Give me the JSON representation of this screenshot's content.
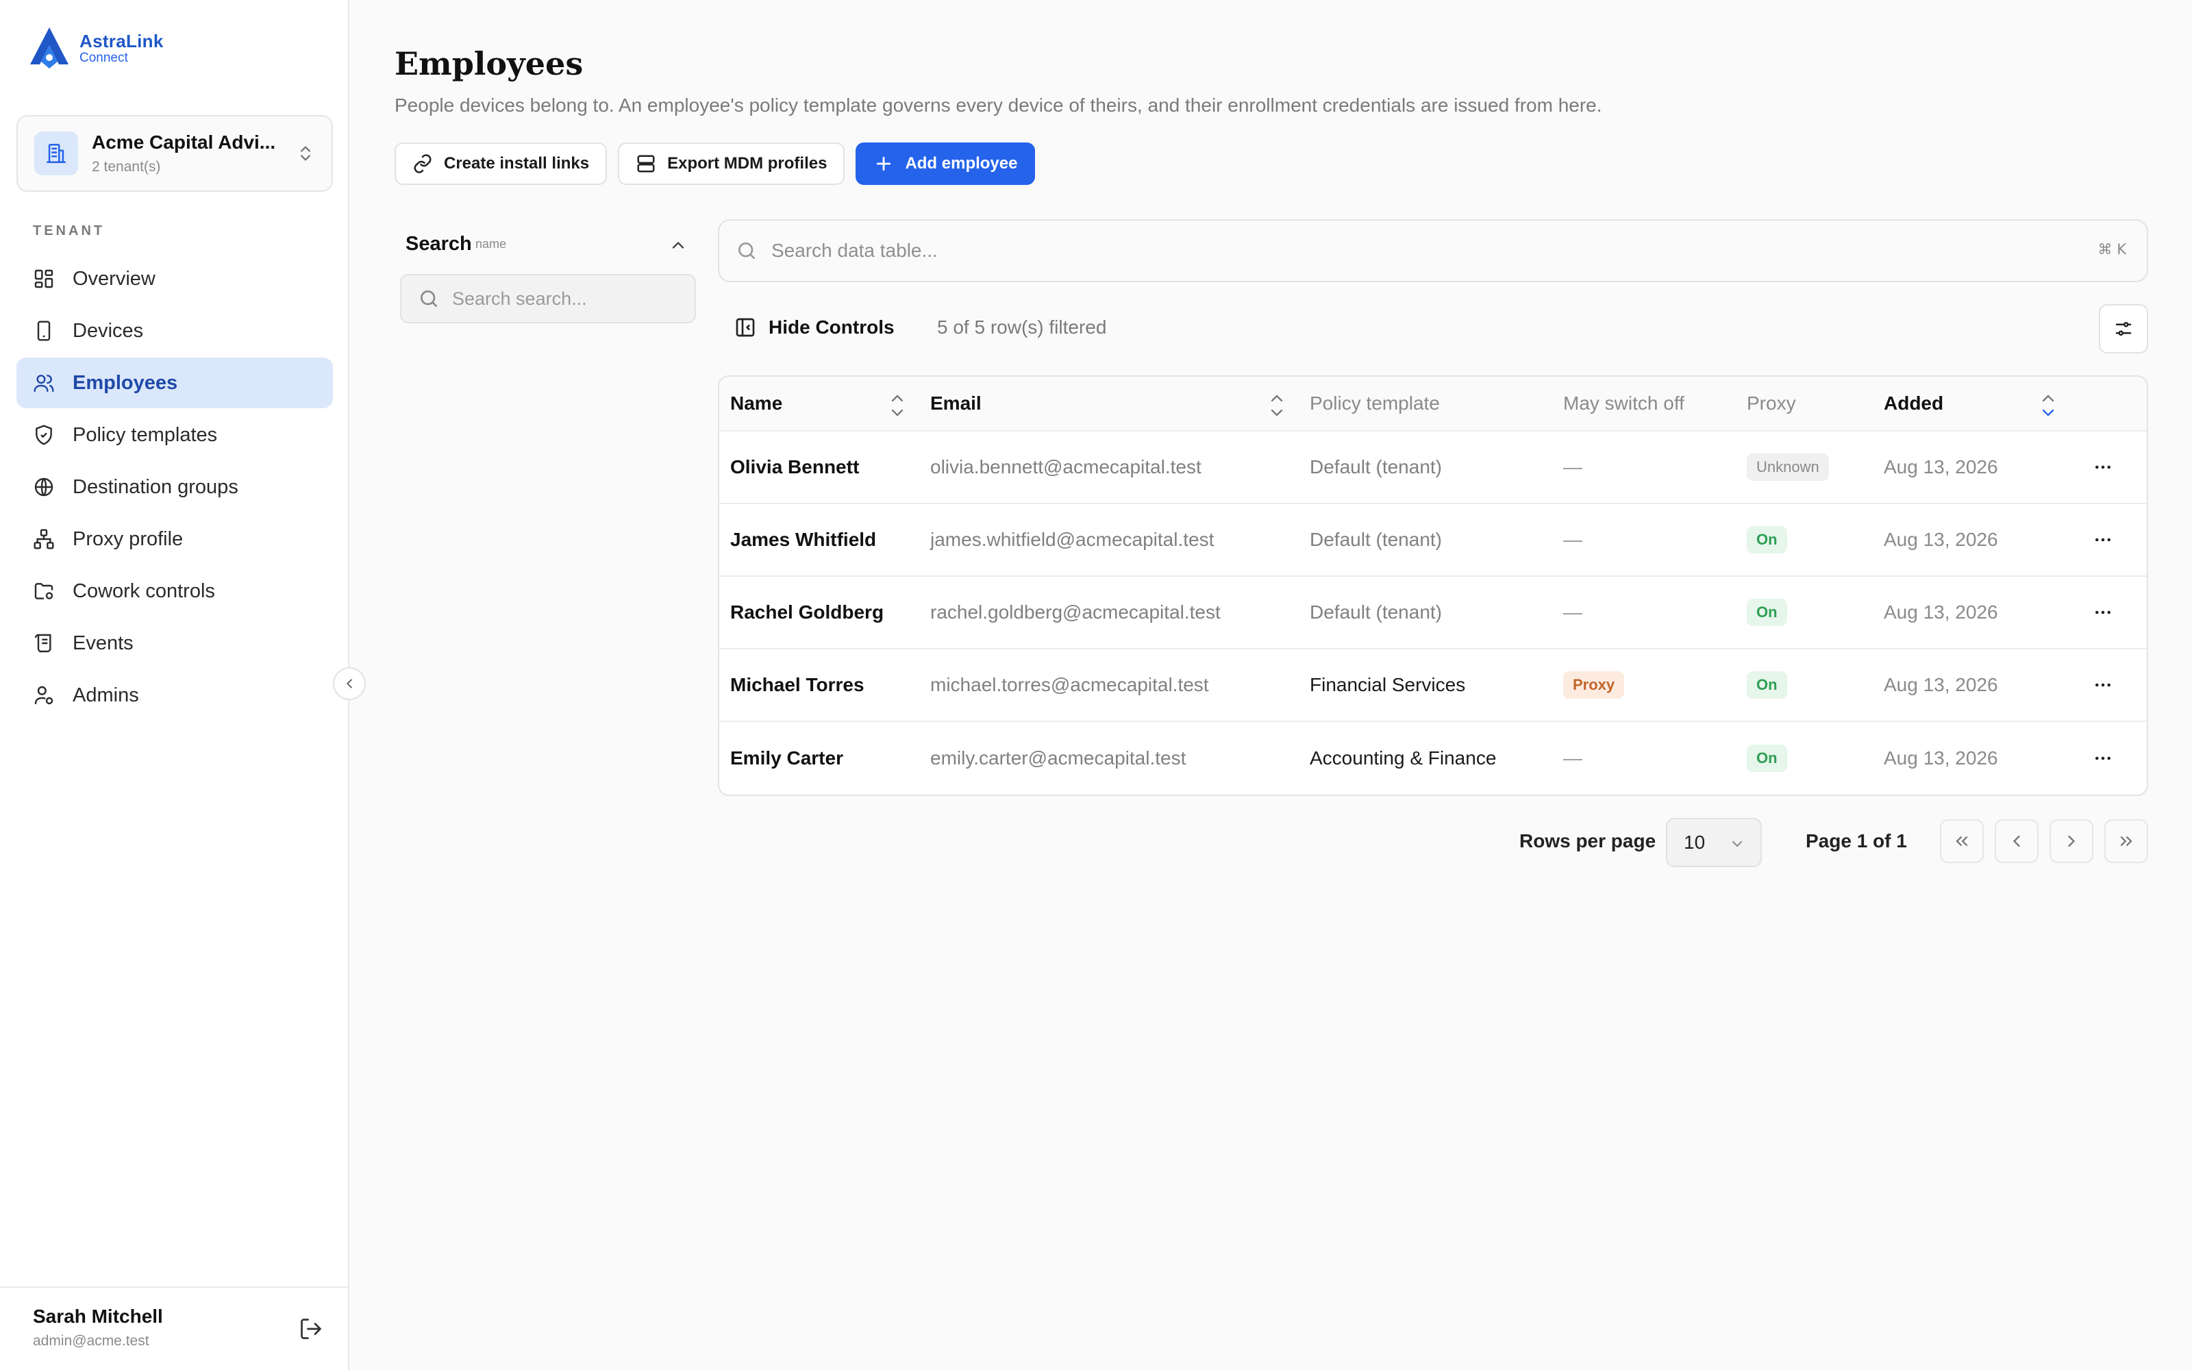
{
  "brand": {
    "name": "AstraLink",
    "sub": "Connect"
  },
  "tenant": {
    "name": "Acme Capital Advi...",
    "count": "2 tenant(s)"
  },
  "sidebar": {
    "section": "TENANT",
    "items": [
      {
        "label": "Overview",
        "icon": "grid-icon"
      },
      {
        "label": "Devices",
        "icon": "phone-icon"
      },
      {
        "label": "Employees",
        "icon": "users-icon",
        "active": true
      },
      {
        "label": "Policy templates",
        "icon": "shield-icon"
      },
      {
        "label": "Destination groups",
        "icon": "globe-icon"
      },
      {
        "label": "Proxy profile",
        "icon": "network-icon"
      },
      {
        "label": "Cowork controls",
        "icon": "folder-settings-icon"
      },
      {
        "label": "Events",
        "icon": "scroll-icon"
      },
      {
        "label": "Admins",
        "icon": "user-cog-icon"
      }
    ]
  },
  "user": {
    "name": "Sarah Mitchell",
    "email": "admin@acme.test"
  },
  "page": {
    "title": "Employees",
    "description": "People devices belong to. An employee's policy template governs every device of theirs, and their enrollment credentials are issued from here."
  },
  "actions": {
    "create_links": "Create install links",
    "export_mdm": "Export MDM profiles",
    "add_employee": "Add employee"
  },
  "filter": {
    "title": "Search",
    "subtitle": "name",
    "placeholder": "Search search..."
  },
  "table_search": {
    "placeholder": "Search data table...",
    "shortcut": "⌘ K"
  },
  "controls": {
    "hide_label": "Hide Controls",
    "filtered": "5 of 5 row(s) filtered"
  },
  "table": {
    "columns": {
      "name": "Name",
      "email": "Email",
      "policy": "Policy template",
      "switch": "May switch off",
      "proxy": "Proxy",
      "added": "Added"
    },
    "rows": [
      {
        "name": "Olivia Bennett",
        "email": "olivia.bennett@acmecapital.test",
        "policy": "Default (tenant)",
        "switch": "—",
        "proxy": "Unknown",
        "added": "Aug 13, 2026"
      },
      {
        "name": "James Whitfield",
        "email": "james.whitfield@acmecapital.test",
        "policy": "Default (tenant)",
        "switch": "—",
        "proxy": "On",
        "added": "Aug 13, 2026"
      },
      {
        "name": "Rachel Goldberg",
        "email": "rachel.goldberg@acmecapital.test",
        "policy": "Default (tenant)",
        "switch": "—",
        "proxy": "On",
        "added": "Aug 13, 2026"
      },
      {
        "name": "Michael Torres",
        "email": "michael.torres@acmecapital.test",
        "policy": "Financial Services",
        "switch": "Proxy",
        "proxy": "On",
        "added": "Aug 13, 2026"
      },
      {
        "name": "Emily Carter",
        "email": "emily.carter@acmecapital.test",
        "policy": "Accounting & Finance",
        "switch": "—",
        "proxy": "On",
        "added": "Aug 13, 2026"
      }
    ]
  },
  "pagination": {
    "rows_label": "Rows per page",
    "rows_value": "10",
    "page_info": "Page 1 of 1"
  },
  "colors": {
    "accent": "#2563eb",
    "active_bg": "#dbe7fb",
    "on_bg": "#e6f6ea",
    "on_text": "#2f9e55",
    "proxy_bg": "#fdebe0",
    "proxy_text": "#c2652a"
  }
}
